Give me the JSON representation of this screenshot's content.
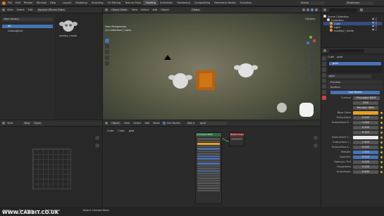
{
  "topbar": {
    "menus": [
      "File",
      "Edit",
      "Render",
      "Window",
      "Help"
    ],
    "workspaces": [
      "Layout",
      "Modeling",
      "Sculpting",
      "UV Editing",
      "Texture Paint",
      "Shading",
      "Animation",
      "Rendering",
      "Compositing",
      "Geometry Nodes",
      "Scripting"
    ],
    "active_workspace": "Shading",
    "scene": "Scene",
    "view_layer": "ViewLayer"
  },
  "asset_browser": {
    "editor_menu": [
      "View",
      "Select",
      "Edit"
    ],
    "append_mode": "Append (Reuse Data)",
    "library": "User Library",
    "catalogs": [
      "All",
      "Unassigned"
    ],
    "asset_label": "monkey | mode"
  },
  "viewport": {
    "mode": "Object Mode",
    "menus": [
      "View",
      "Select",
      "Add",
      "Object"
    ],
    "orientation": "Global",
    "title": "User Perspective",
    "subtitle": "(1) Collection | Cube",
    "options": "Options"
  },
  "outliner": {
    "root": "Scene Collection",
    "items": [
      "Collection",
      "Cube",
      "Light",
      "monkey | mode"
    ]
  },
  "properties": {
    "breadcrumb_object": "Cube",
    "breadcrumb_material": "gold",
    "slot": "gold",
    "material_name": "gold",
    "preview_label": "Preview",
    "surface_label": "Surface",
    "use_nodes": "Use Nodes",
    "surface_field_label": "Surface",
    "surface_value": "Principled BSDF",
    "distribution": "GGX",
    "subsurface_method": "Random Walk",
    "rows": [
      {
        "label": "Base Color",
        "value": ""
      },
      {
        "label": "Subsurface",
        "value": "0.000"
      },
      {
        "label": "Subsurface R...",
        "value": "1.000"
      },
      {
        "label": "",
        "value": "0.200"
      },
      {
        "label": "",
        "value": "0.100"
      },
      {
        "label": "Subsurface C...",
        "value": ""
      },
      {
        "label": "Subsurface I...",
        "value": "1.400"
      },
      {
        "label": "Subsurface A...",
        "value": "0.000"
      },
      {
        "label": "Metallic",
        "value": "1.000"
      },
      {
        "label": "Specular",
        "value": "0.500"
      },
      {
        "label": "Specular Tint",
        "value": "0.000"
      },
      {
        "label": "Roughness",
        "value": "0.200"
      },
      {
        "label": "Anisotropic",
        "value": "0.000"
      }
    ],
    "base_color": "#e8a020"
  },
  "file_browser": {
    "menus": [
      "View"
    ],
    "new_label": "New",
    "open_label": "Open"
  },
  "node_editor": {
    "object": "Object",
    "menus": [
      "View",
      "Select",
      "Add",
      "Node"
    ],
    "use_nodes": "Use Nodes",
    "slot": "Slot 1",
    "material": "gold",
    "breadcrumb": [
      "Cube",
      "Cube",
      "gold"
    ],
    "node_title": "Principled BSDF",
    "output_title": "Material Output"
  },
  "statusbar": {
    "items": [
      "Select",
      "Box Select",
      "Rotate View",
      "Object Context Menu"
    ]
  },
  "watermark": "WWW.CABBIT.CO.UK"
}
